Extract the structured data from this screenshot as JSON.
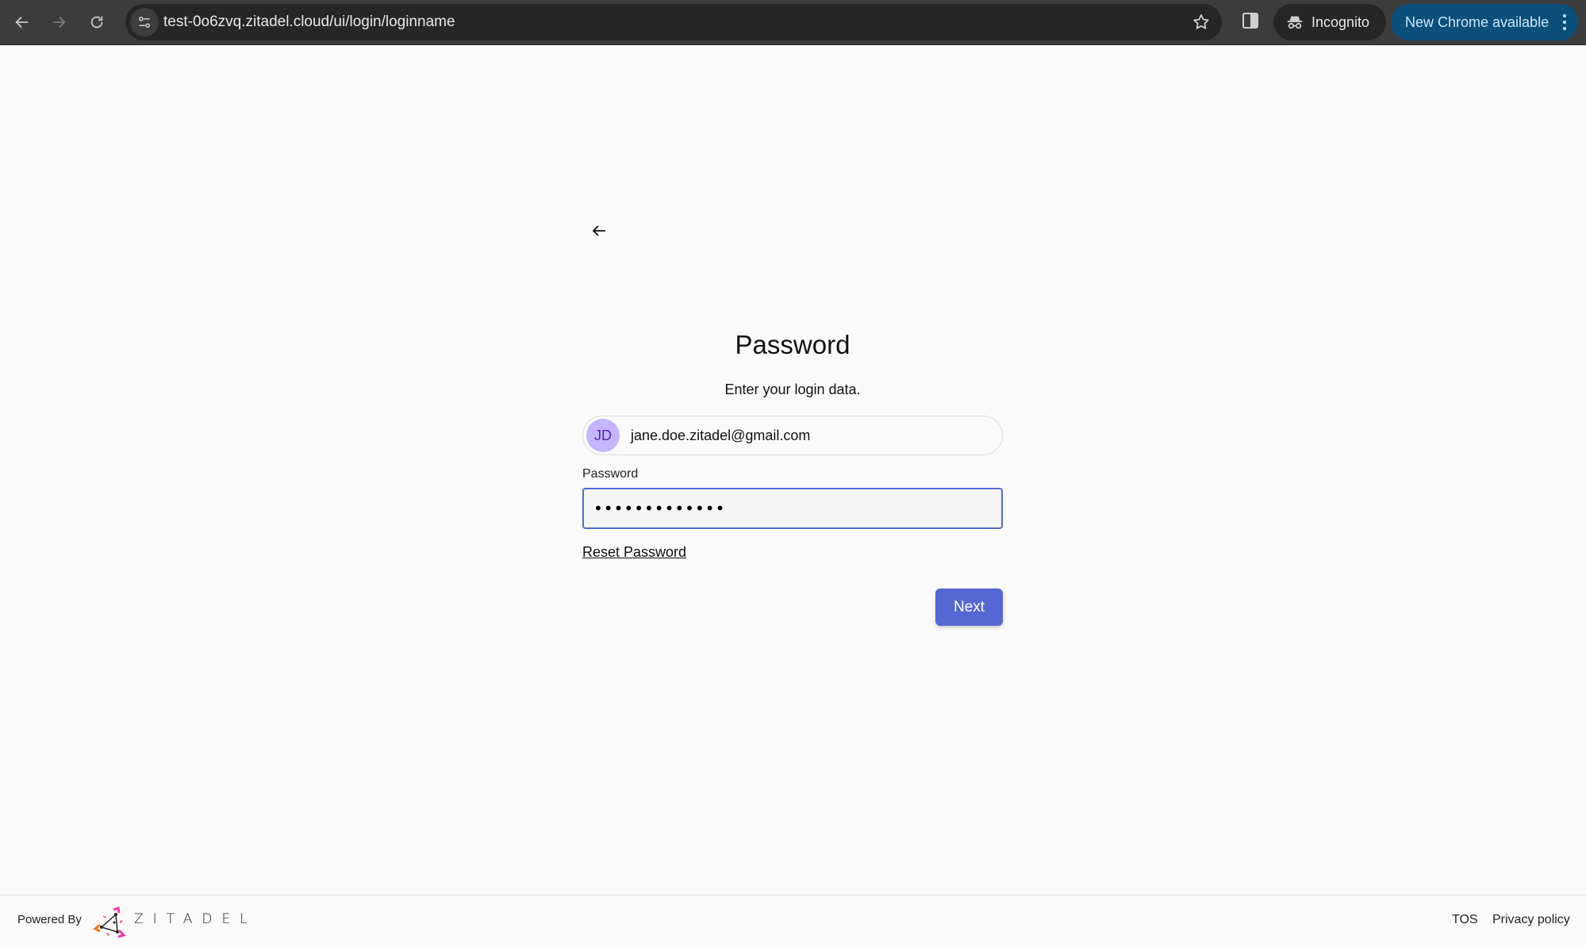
{
  "browser": {
    "url": "test-0o6zvq.zitadel.cloud/ui/login/loginname",
    "incognito_label": "Incognito",
    "update_label": "New Chrome available",
    "icons": {
      "back": "arrow-left-icon",
      "forward": "arrow-right-icon",
      "reload": "reload-icon",
      "site_info": "tune-icon",
      "bookmark": "star-icon",
      "side_panel": "side-panel-icon",
      "incognito": "incognito-icon",
      "menu": "kebab-menu-icon"
    }
  },
  "page": {
    "back_icon": "arrow-left-icon",
    "title": "Password",
    "subtitle": "Enter your login data.",
    "user": {
      "initials": "JD",
      "email": "jane.doe.zitadel@gmail.com"
    },
    "password_field": {
      "label": "Password",
      "value": "•••••••••••••"
    },
    "reset_link": "Reset Password",
    "next_button": "Next"
  },
  "footer": {
    "powered_by": "Powered By",
    "brand": "ZITADEL",
    "links": [
      "TOS",
      "Privacy policy"
    ]
  },
  "colors": {
    "accent": "#5469d4",
    "avatar_bg": "#c4b5fd",
    "avatar_text": "#5b21b6",
    "chrome_update_badge": "#0b4f7b"
  }
}
